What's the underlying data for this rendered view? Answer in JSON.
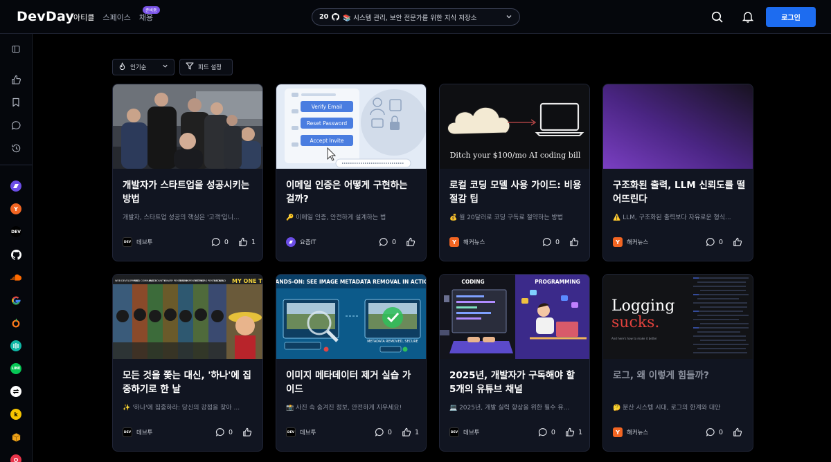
{
  "header": {
    "logo": "DevDay",
    "nav": [
      {
        "label": "아티클"
      },
      {
        "label": "스페이스"
      },
      {
        "label": "채용"
      }
    ],
    "nav_badge": "준비중",
    "search_pill": {
      "count": "20",
      "text": "📚 시스템 관리, 보안 전문가를 위한 지식 저장소"
    },
    "login_label": "로그인"
  },
  "filters": {
    "sort_label": "인기순",
    "feed_label": "피드 설정"
  },
  "cards": [
    {
      "title": "개발자가 스타트업을 성공시키는 방법",
      "desc": "개발자, 스타트업 성공의 핵심은 '고객'입니...",
      "source": "데브투",
      "comments": "0",
      "likes": "1"
    },
    {
      "title": "이메일 인증은 어떻게 구현하는 걸까?",
      "desc": "🔑 이메일 인증, 안전하게 설계하는 법",
      "source": "요즘IT",
      "comments": "0",
      "likes": ""
    },
    {
      "title": "로컬 코딩 모델 사용 가이드: 비용 절감 팁",
      "desc": "💰 월 20달러로 코딩 구독료 절약하는 방법",
      "source": "해커뉴스",
      "comments": "0",
      "likes": ""
    },
    {
      "title": "구조화된 출력, LLM 신뢰도를 떨어뜨린다",
      "desc": "⚠️ LLM, 구조화된 출력보다 자유로운 형식...",
      "source": "해커뉴스",
      "comments": "0",
      "likes": ""
    },
    {
      "title": "모든 것을 쫓는 대신, '하나'에 집중하기로 한 날",
      "desc": "✨ '하나'에 집중하라: 당신의 강점을 찾아 ...",
      "source": "데브투",
      "comments": "0",
      "likes": ""
    },
    {
      "title": "이미지 메타데이터 제거 실습 가이드",
      "desc": "📸 사진 속 숨겨진 정보, 안전하게 지우세요!",
      "source": "데브투",
      "comments": "0",
      "likes": "1"
    },
    {
      "title": "2025년, 개발자가 구독해야 할 5개의 유튜브 채널",
      "desc": "💻 2025년, 개발 실력 향상을 위한 필수 유...",
      "source": "데브투",
      "comments": "0",
      "likes": "1"
    },
    {
      "title": "로그, 왜 이렇게 힘들까?",
      "desc": "🤔 분산 시스템 시대, 로그의 한계와 대안",
      "source": "해커뉴스",
      "comments": "0",
      "likes": ""
    }
  ],
  "thumbs": {
    "email": {
      "b1": "Verify Email",
      "b2": "Reset Password",
      "b3": "Accept Invite"
    },
    "local": {
      "caption": "Ditch your $100/mo AI coding bill"
    },
    "meta": {
      "banner": "HANDS-ON: SEE IMAGE METADATA REMOVAL IN ACTION",
      "status": "METADATA REMOVED, SECURE"
    },
    "yt": {
      "left": "CODING",
      "right": "PROGRAMMING"
    },
    "log": {
      "line1": "Logging",
      "line2": "sucks.",
      "sub": "And here's how to make it better"
    },
    "anime": {
      "tags": [
        "WEB DEVELOPMENT",
        "PARA COMMANDO",
        "BUG BOUNTY",
        "BINARY PENTESTING",
        "BINARY PENTESTING",
        "NETWORK PENTESTING",
        "BACKEND",
        "MY ONE THI"
      ]
    }
  },
  "colors": {
    "accent": "#1d6cf0",
    "badge": "#7b55e8",
    "yozm": "#6b4de6",
    "hacker": "#f26522"
  }
}
